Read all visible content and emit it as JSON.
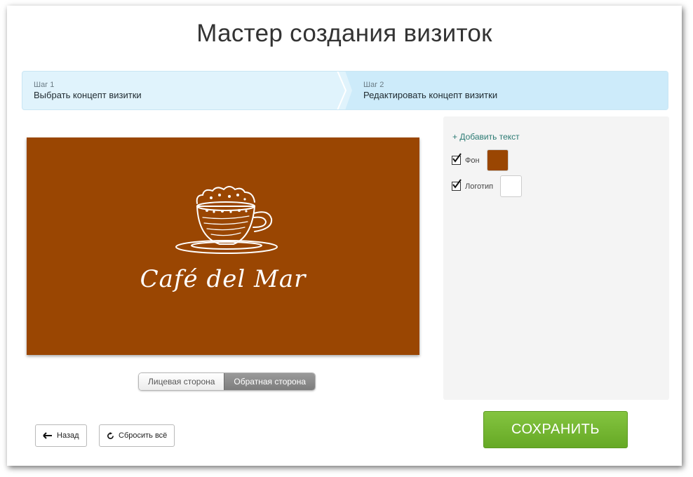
{
  "header": {
    "title": "Мастер создания визиток"
  },
  "wizard": {
    "steps": [
      {
        "number": "Шаг 1",
        "label": "Выбрать концепт визитки"
      },
      {
        "number": "Шаг 2",
        "label": "Редактировать концепт визитки"
      }
    ]
  },
  "preview": {
    "card_text": "Café del Mar",
    "background_color": "#9a4602",
    "logo_icon": "coffee-cup-icon"
  },
  "side_toggle": {
    "front": "Лицевая сторона",
    "back": "Обратная сторона",
    "selected": "Обратная сторона"
  },
  "panel": {
    "add_text": "+ Добавить текст",
    "options": [
      {
        "label": "Фон",
        "checked": true,
        "swatch_color": "#9a4602"
      },
      {
        "label": "Логотип",
        "checked": true,
        "swatch_color": "#ffffff"
      }
    ]
  },
  "buttons": {
    "back": "Назад",
    "reset": "Сбросить всё",
    "save": "СОХРАНИТЬ"
  },
  "colors": {
    "accent_green": "#72b32f",
    "step_blue": "#e0f3fc",
    "link_teal": "#2b7a73"
  }
}
